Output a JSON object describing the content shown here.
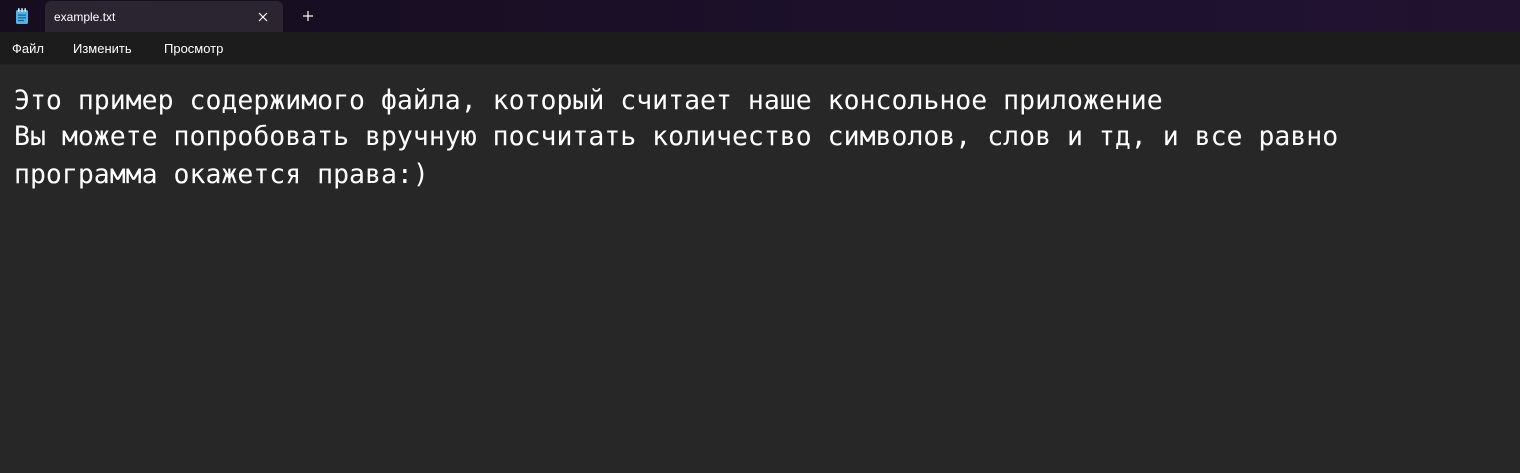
{
  "titlebar": {
    "app_icon": "notepad-icon",
    "tab": {
      "title": "example.txt",
      "close_icon": "close-icon"
    },
    "new_tab_icon": "plus-icon"
  },
  "menu": {
    "file": "Файл",
    "edit": "Изменить",
    "view": "Просмотр"
  },
  "editor": {
    "lines": [
      "Это пример содержимого файла, который считает наше консольное приложение",
      "Вы можете попробовать вручную посчитать количество символов, слов и тд, и все равно",
      "программа окажется права:)"
    ]
  },
  "colors": {
    "titlebar": "#1a0f26",
    "tab": "#2a2530",
    "menubar": "#1c1c1c",
    "editor_bg": "#272727",
    "text": "#ffffff",
    "icon_accent": "#4fb3e8"
  }
}
